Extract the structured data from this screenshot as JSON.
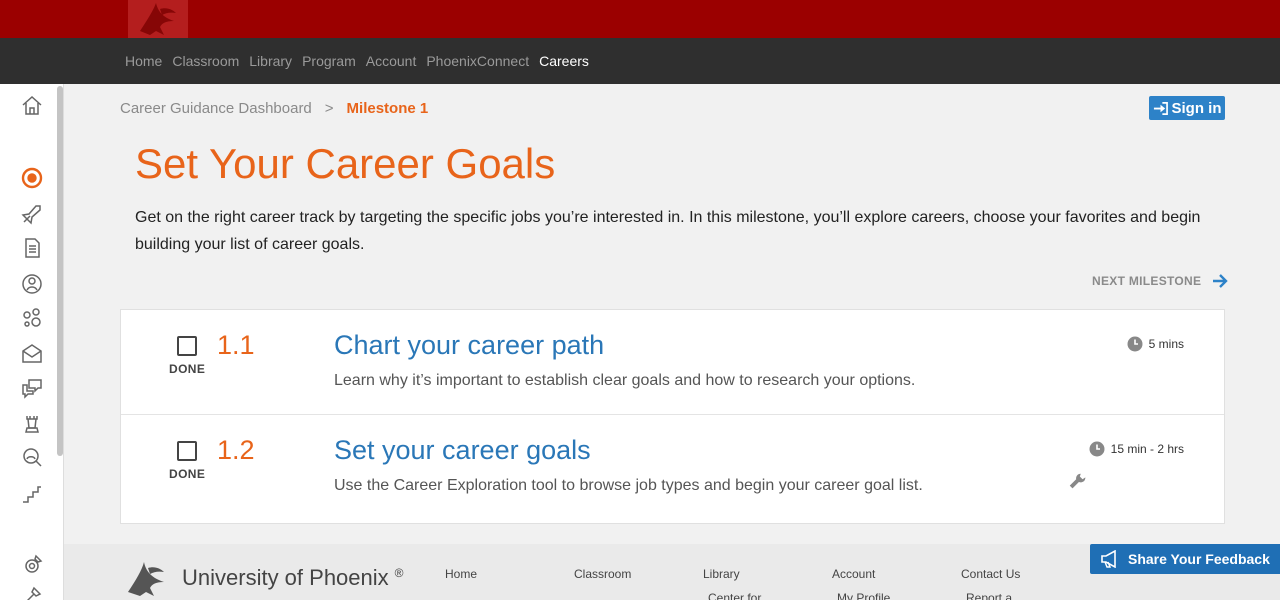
{
  "nav": {
    "items": [
      {
        "label": "Home"
      },
      {
        "label": "Classroom"
      },
      {
        "label": "Library"
      },
      {
        "label": "Program"
      },
      {
        "label": "Account"
      },
      {
        "label": "PhoenixConnect"
      },
      {
        "label": "Careers"
      }
    ],
    "active": "Careers"
  },
  "breadcrumb": {
    "parent": "Career Guidance Dashboard",
    "separator": ">",
    "current": "Milestone 1"
  },
  "signin": {
    "label": "Sign in"
  },
  "page": {
    "title": "Set Your Career Goals",
    "intro": "Get on the right career track by targeting the specific jobs you’re interested in. In this milestone, you’ll explore careers, choose your favorites and begin building your list of career goals."
  },
  "next_milestone": {
    "label": "NEXT MILESTONE"
  },
  "steps": [
    {
      "done_label": "DONE",
      "number": "1.1",
      "title": "Chart your career path",
      "description": "Learn why it’s important to establish clear goals and how to research your options.",
      "time": "5 mins"
    },
    {
      "done_label": "DONE",
      "number": "1.2",
      "title": "Set your career goals",
      "description": "Use the Career Exploration tool to browse job types and begin your career goal list.",
      "time": "15 min - 2 hrs"
    }
  ],
  "footer": {
    "logo_text": "University of Phoenix",
    "logo_mark": "®",
    "columns": [
      {
        "label": "Home"
      },
      {
        "label": "Classroom"
      },
      {
        "label": "Library",
        "sub": "Center for"
      },
      {
        "label": "Account",
        "sub": "My Profile"
      },
      {
        "label": "Contact Us",
        "sub": "Report a"
      }
    ]
  },
  "feedback": {
    "label": "Share Your Feedback"
  },
  "colors": {
    "brand_red": "#9b0000",
    "accent_orange": "#e8641a",
    "link_blue": "#2a77b7",
    "button_blue": "#2d82c8"
  }
}
